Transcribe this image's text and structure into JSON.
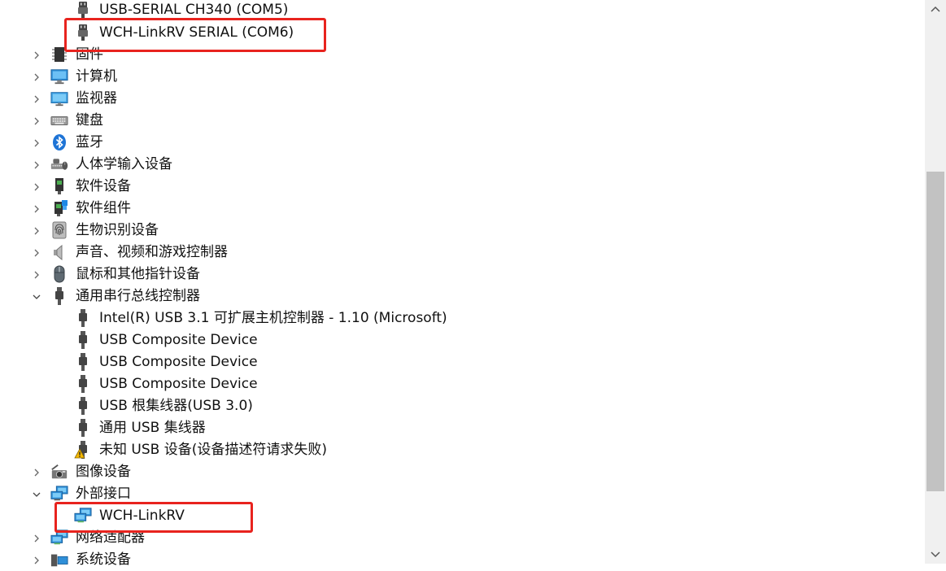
{
  "device_tree": {
    "items": [
      {
        "label": "USB-SERIAL CH340 (COM5)",
        "level": 1,
        "icon": "serial-port-icon"
      },
      {
        "label": "WCH-LinkRV SERIAL (COM6)",
        "level": 1,
        "icon": "serial-port-icon",
        "highlighted": true
      },
      {
        "label": "固件",
        "level": 0,
        "expanded": false,
        "icon": "firmware-icon"
      },
      {
        "label": "计算机",
        "level": 0,
        "expanded": false,
        "icon": "computer-icon"
      },
      {
        "label": "监视器",
        "level": 0,
        "expanded": false,
        "icon": "monitor-icon"
      },
      {
        "label": "键盘",
        "level": 0,
        "expanded": false,
        "icon": "keyboard-icon"
      },
      {
        "label": "蓝牙",
        "level": 0,
        "expanded": false,
        "icon": "bluetooth-icon"
      },
      {
        "label": "人体学输入设备",
        "level": 0,
        "expanded": false,
        "icon": "hid-icon"
      },
      {
        "label": "软件设备",
        "level": 0,
        "expanded": false,
        "icon": "software-device-icon"
      },
      {
        "label": "软件组件",
        "level": 0,
        "expanded": false,
        "icon": "software-component-icon"
      },
      {
        "label": "生物识别设备",
        "level": 0,
        "expanded": false,
        "icon": "fingerprint-icon"
      },
      {
        "label": "声音、视频和游戏控制器",
        "level": 0,
        "expanded": false,
        "icon": "speaker-icon"
      },
      {
        "label": "鼠标和其他指针设备",
        "level": 0,
        "expanded": false,
        "icon": "mouse-icon"
      },
      {
        "label": "通用串行总线控制器",
        "level": 0,
        "expanded": true,
        "icon": "usb-icon"
      },
      {
        "label": "Intel(R) USB 3.1 可扩展主机控制器 - 1.10 (Microsoft)",
        "level": 1,
        "icon": "usb-icon"
      },
      {
        "label": "USB Composite Device",
        "level": 1,
        "icon": "usb-icon"
      },
      {
        "label": "USB Composite Device",
        "level": 1,
        "icon": "usb-icon"
      },
      {
        "label": "USB Composite Device",
        "level": 1,
        "icon": "usb-icon"
      },
      {
        "label": "USB 根集线器(USB 3.0)",
        "level": 1,
        "icon": "usb-icon"
      },
      {
        "label": "通用 USB 集线器",
        "level": 1,
        "icon": "usb-icon"
      },
      {
        "label": "未知 USB 设备(设备描述符请求失败)",
        "level": 1,
        "icon": "usb-warning-icon"
      },
      {
        "label": "图像设备",
        "level": 0,
        "expanded": false,
        "icon": "camera-icon"
      },
      {
        "label": "外部接口",
        "level": 0,
        "expanded": true,
        "icon": "network-icon"
      },
      {
        "label": "WCH-LinkRV",
        "level": 1,
        "icon": "network-icon",
        "highlighted": true
      },
      {
        "label": "网络适配器",
        "level": 0,
        "expanded": false,
        "icon": "network-icon"
      },
      {
        "label": "系统设备",
        "level": 0,
        "expanded": false,
        "icon": "system-icon"
      }
    ]
  },
  "colors": {
    "highlight": "#e8231e",
    "scrollbar_track": "#f0f0f0",
    "scrollbar_thumb": "#c2c2c2"
  }
}
